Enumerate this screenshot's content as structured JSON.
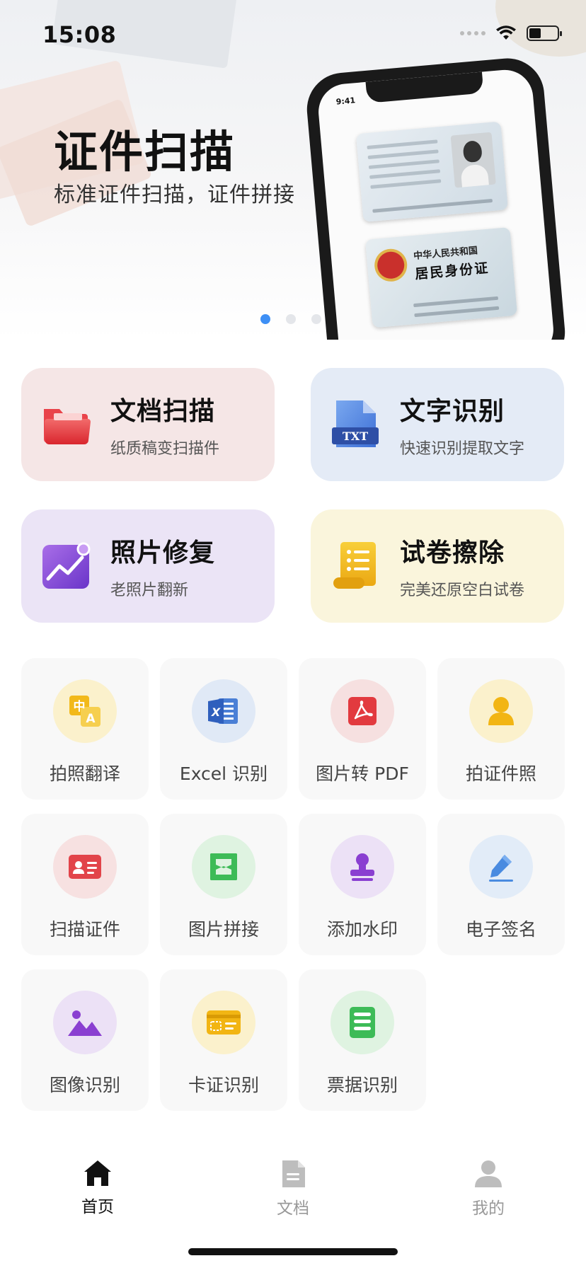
{
  "status_bar": {
    "time": "15:08"
  },
  "banner": {
    "title": "证件扫描",
    "subtitle": "标准证件扫描，证件拼接",
    "phone_time": "9:41",
    "id_back_line1": "中华人民共和国",
    "id_back_line2": "居民身份证",
    "pages": 3,
    "active_page": 1
  },
  "features": [
    {
      "title": "文档扫描",
      "subtitle": "纸质稿变扫描件",
      "icon": "folder-icon"
    },
    {
      "title": "文字识别",
      "subtitle": "快速识别提取文字",
      "icon": "txt-file-icon",
      "icon_text": "TXT"
    },
    {
      "title": "照片修复",
      "subtitle": "老照片翻新",
      "icon": "photo-chart-icon"
    },
    {
      "title": "试卷擦除",
      "subtitle": "完美还原空白试卷",
      "icon": "scroll-paper-icon"
    }
  ],
  "tools": [
    {
      "label": "拍照翻译",
      "icon": "translate-icon",
      "icon_text_a": "中",
      "icon_text_b": "A"
    },
    {
      "label": "Excel 识别",
      "icon": "excel-icon",
      "icon_text": "X"
    },
    {
      "label": "图片转 PDF",
      "icon": "pdf-icon"
    },
    {
      "label": "拍证件照",
      "icon": "id-photo-icon"
    },
    {
      "label": "扫描证件",
      "icon": "id-card-icon"
    },
    {
      "label": "图片拼接",
      "icon": "stitch-icon"
    },
    {
      "label": "添加水印",
      "icon": "stamp-icon"
    },
    {
      "label": "电子签名",
      "icon": "pen-icon"
    },
    {
      "label": "图像识别",
      "icon": "image-icon"
    },
    {
      "label": "卡证识别",
      "icon": "card-icon"
    },
    {
      "label": "票据识别",
      "icon": "receipt-icon"
    }
  ],
  "tabbar": [
    {
      "label": "首页",
      "icon": "home-icon",
      "active": true
    },
    {
      "label": "文档",
      "icon": "document-icon",
      "active": false
    },
    {
      "label": "我的",
      "icon": "user-icon",
      "active": false
    }
  ],
  "colors": {
    "accent_blue": "#3d8ff5",
    "card_pink": "#f5e6e6",
    "card_blue": "#e4ebf6",
    "card_purple": "#ebe4f6",
    "card_yellow": "#faf5dc",
    "tool_bg": "#f8f8f8"
  }
}
